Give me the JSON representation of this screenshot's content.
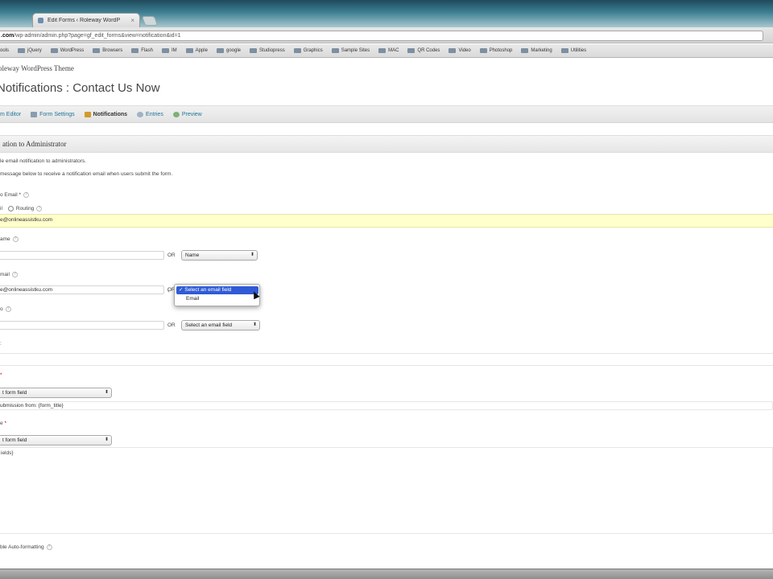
{
  "browser": {
    "tab_title": "Edit Forms ‹ Roleway WordP",
    "url_domain": ".com",
    "url_path": "/wp-admin/admin.php?page=gf_edit_forms&view=notification&id=1",
    "bookmarks": [
      "ools",
      "jQuery",
      "WordPress",
      "Browsers",
      "Flash",
      "IM",
      "Apple",
      "google",
      "Studiopress",
      "Graphics",
      "Sample Sites",
      "MAC",
      "QR Codes",
      "Video",
      "Photoshop",
      "Marketing",
      "Utilities"
    ]
  },
  "site_name": "oleway WordPress Theme",
  "page_title": "Notifications : Contact Us Now",
  "subnav": [
    {
      "label": "m Editor"
    },
    {
      "label": "Form Settings"
    },
    {
      "label": "Notifications"
    },
    {
      "label": "Entries"
    },
    {
      "label": "Preview"
    }
  ],
  "section_header": "ation to Administrator",
  "form": {
    "enable_text": "le email notification to administrators.",
    "instructions": "message below to receive a notification email when users submit the form.",
    "send_to_label": "o Email",
    "send_to_required": "*",
    "radio_label_left": "il",
    "radio_routing": "Routing",
    "send_to_value": "e@onlineassistku.com",
    "from_name_label": "ame",
    "or_text": "OR",
    "from_name_select": "Name",
    "from_email_label": "mail",
    "from_email_value": "e@onlineassistku.com",
    "reply_to_label": "o",
    "reply_to_select": "Select an email field",
    "misc_label": ":",
    "subject_marker": "*",
    "subject_select": "t form field",
    "subject_value": "ubmission from: {form_title}",
    "message_label": "e",
    "message_required": "*",
    "message_select": "t form field",
    "message_value": "ields}",
    "autoformat_label": "ble Auto-formatting"
  },
  "dropdown": {
    "selected": "✓ Select an email field",
    "option": "Email"
  }
}
